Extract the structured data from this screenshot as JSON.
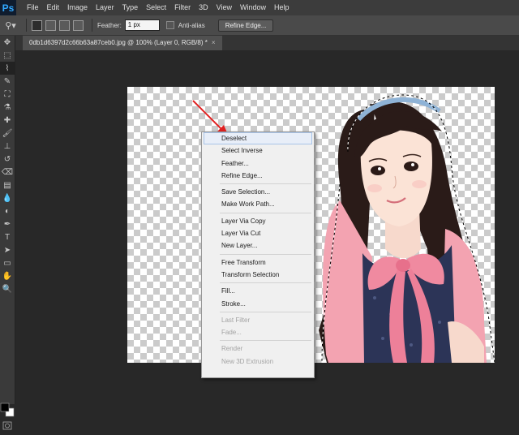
{
  "app": {
    "logo": "Ps"
  },
  "menubar": [
    "File",
    "Edit",
    "Image",
    "Layer",
    "Type",
    "Select",
    "Filter",
    "3D",
    "View",
    "Window",
    "Help"
  ],
  "options": {
    "feather_label": "Feather:",
    "feather_value": "1 px",
    "antialias_label": "Anti-alias",
    "refine_label": "Refine Edge..."
  },
  "document": {
    "tab_title": "0db1d6397d2c66b63a87ceb0.jpg @ 100% (Layer 0, RGB/8) *",
    "close": "×"
  },
  "context_menu": {
    "groups": [
      [
        {
          "label": "Deselect",
          "highlighted": true
        },
        {
          "label": "Select Inverse"
        },
        {
          "label": "Feather..."
        },
        {
          "label": "Refine Edge..."
        }
      ],
      [
        {
          "label": "Save Selection..."
        },
        {
          "label": "Make Work Path..."
        }
      ],
      [
        {
          "label": "Layer Via Copy"
        },
        {
          "label": "Layer Via Cut"
        },
        {
          "label": "New Layer..."
        }
      ],
      [
        {
          "label": "Free Transform"
        },
        {
          "label": "Transform Selection"
        }
      ],
      [
        {
          "label": "Fill..."
        },
        {
          "label": "Stroke..."
        }
      ],
      [
        {
          "label": "Last Filter",
          "disabled": true
        },
        {
          "label": "Fade...",
          "disabled": true
        }
      ],
      [
        {
          "label": "Render",
          "disabled": true
        },
        {
          "label": "New 3D Extrusion",
          "disabled": true
        }
      ]
    ]
  },
  "tools": [
    "move-tool-icon",
    "marquee-tool-icon",
    "lasso-tool-icon",
    "quick-selection-tool-icon",
    "crop-tool-icon",
    "eyedropper-tool-icon",
    "healing-brush-tool-icon",
    "brush-tool-icon",
    "clone-stamp-tool-icon",
    "history-brush-tool-icon",
    "eraser-tool-icon",
    "gradient-tool-icon",
    "blur-tool-icon",
    "dodge-tool-icon",
    "pen-tool-icon",
    "type-tool-icon",
    "path-selection-tool-icon",
    "shape-tool-icon",
    "hand-tool-icon",
    "zoom-tool-icon"
  ],
  "colors": {
    "menubar": "#3c3c3c",
    "workspace": "#282828",
    "arrow": "#e02020",
    "foreground": "#000000",
    "background": "#ffffff"
  }
}
